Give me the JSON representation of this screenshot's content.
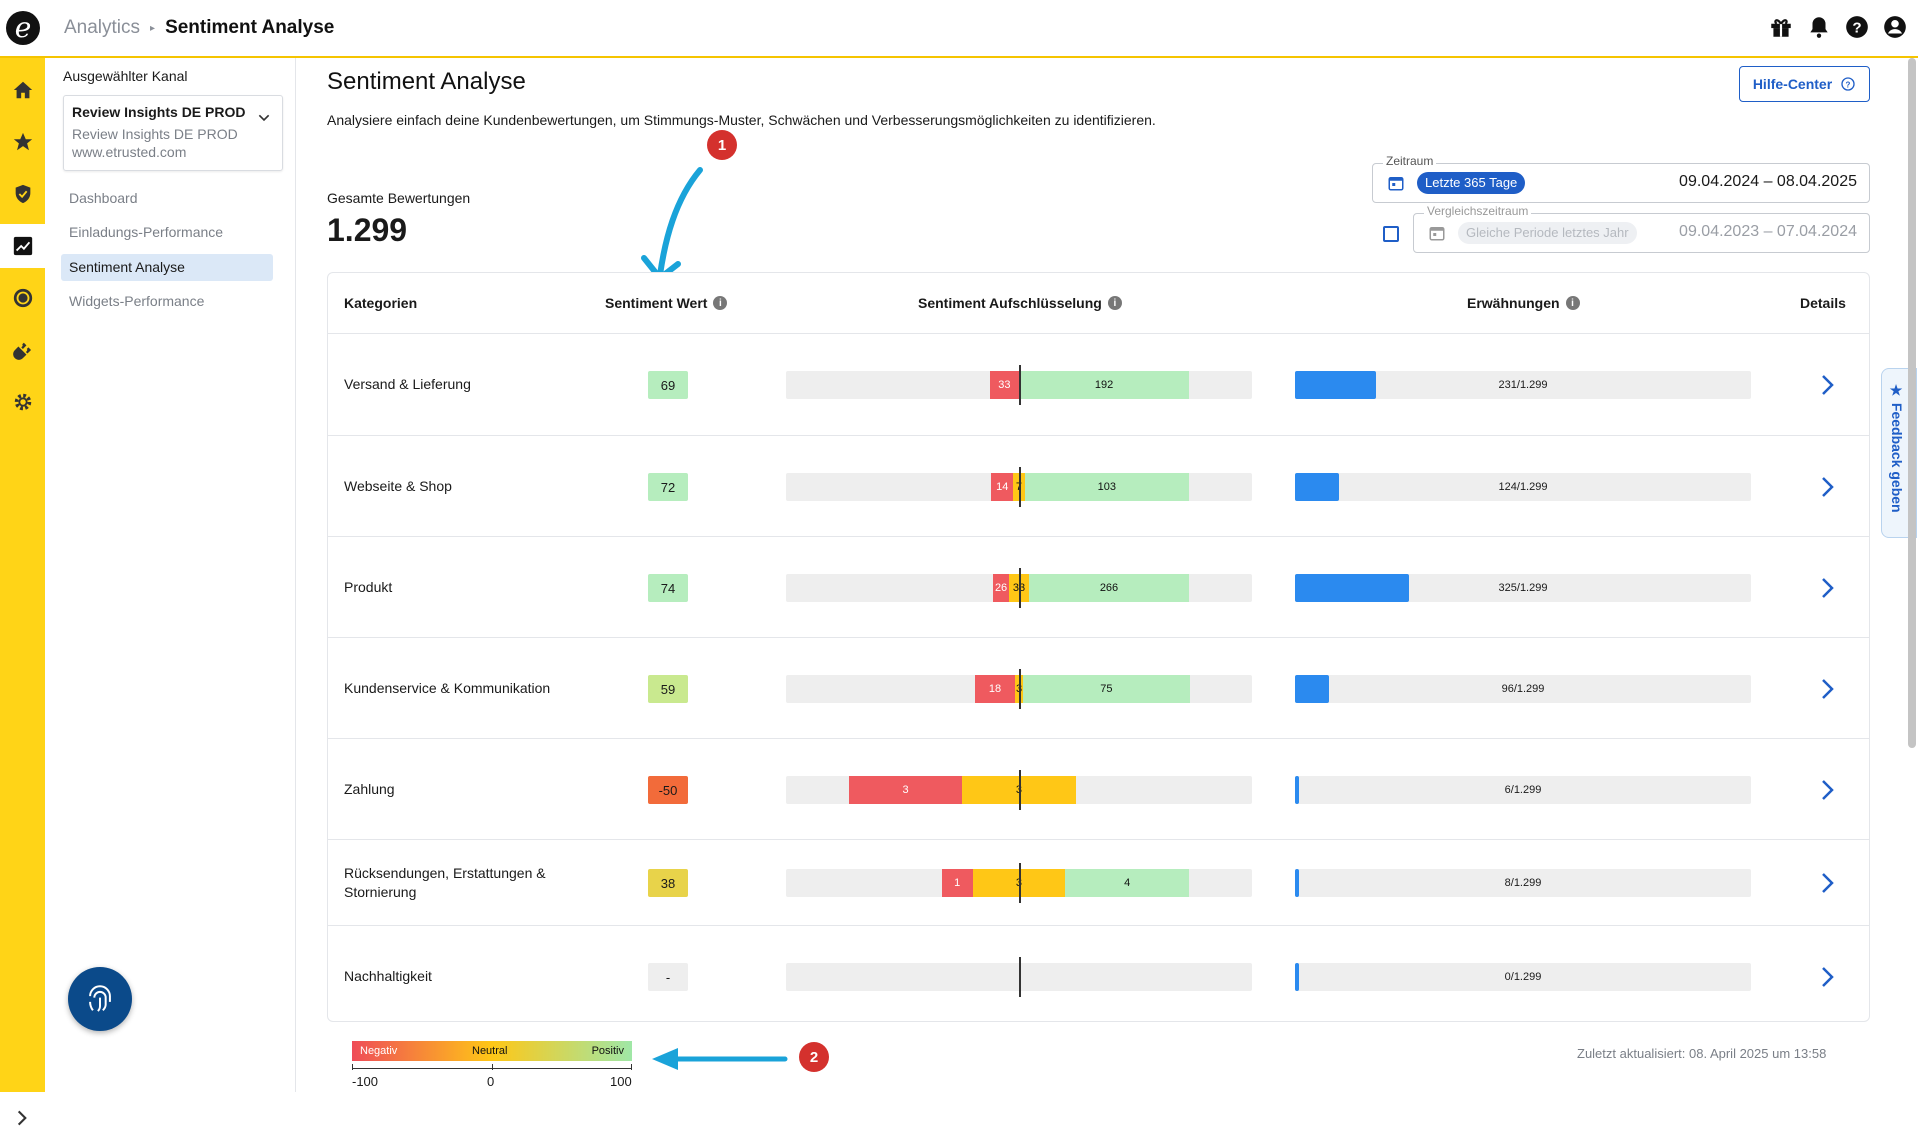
{
  "topbar": {
    "logo_letter": "e",
    "breadcrumb_parent": "Analytics",
    "breadcrumb_current": "Sentiment Analyse",
    "icons": [
      "gift-icon",
      "bell-icon",
      "help-icon",
      "user-icon"
    ]
  },
  "rail": {
    "items": [
      "home-icon",
      "star-icon",
      "shield-icon",
      "analytics-icon",
      "coin-icon",
      "plug-icon",
      "gear-icon"
    ],
    "active": "analytics-icon"
  },
  "sidenav": {
    "channel_label": "Ausgewählter Kanal",
    "channel_name": "Review Insights DE PROD",
    "channel_sub": "Review Insights DE PROD",
    "channel_url": "www.etrusted.com",
    "items": [
      {
        "label": "Dashboard"
      },
      {
        "label": "Einladungs-Performance"
      },
      {
        "label": "Sentiment Analyse"
      },
      {
        "label": "Widgets-Performance"
      }
    ],
    "active_index": 2
  },
  "main": {
    "title": "Sentiment Analyse",
    "description": "Analysiere einfach deine Kundenbewertungen, um Stimmungs-Muster, Schwächen und Verbesserungsmöglichkeiten zu identifizieren.",
    "help_button": "Hilfe-Center",
    "total_label": "Gesamte Bewertungen",
    "total_value": "1.299",
    "period": {
      "legend": "Zeitraum",
      "chip": "Letzte 365 Tage",
      "range": "09.04.2024 – 08.04.2025"
    },
    "compare": {
      "legend": "Vergleichszeitraum",
      "chip": "Gleiche Periode letztes Jahr",
      "range": "09.04.2023 – 07.04.2024",
      "checked": false
    }
  },
  "table": {
    "headers": {
      "category": "Kategorien",
      "score": "Sentiment Wert",
      "breakdown": "Sentiment Aufschlüsselung",
      "mentions": "Erwähnungen",
      "details": "Details"
    },
    "total_reviews": 1299,
    "rows": [
      {
        "category": "Versand & Lieferung",
        "score": "69",
        "score_color": "#b6edbe",
        "negative": "33",
        "neutral": "",
        "positive": "192",
        "mentions": "231/1.299"
      },
      {
        "category": "Webseite & Shop",
        "score": "72",
        "score_color": "#b6edbe",
        "negative": "14",
        "neutral": "7",
        "positive": "103",
        "mentions": "124/1.299"
      },
      {
        "category": "Produkt",
        "score": "74",
        "score_color": "#b6edbe",
        "negative": "26",
        "neutral": "33",
        "positive": "266",
        "mentions": "325/1.299"
      },
      {
        "category": "Kundenservice & Kommunikation",
        "score": "59",
        "score_color": "#c9e98f",
        "negative": "18",
        "neutral": "3",
        "positive": "75",
        "mentions": "96/1.299"
      },
      {
        "category": "Zahlung",
        "score": "-50",
        "score_color": "#f26b3a",
        "negative": "3",
        "neutral": "3",
        "positive": "",
        "mentions": "6/1.299"
      },
      {
        "category": "Rücksendungen, Erstattungen & Stornierung",
        "score": "38",
        "score_color": "#e8d34a",
        "negative": "1",
        "neutral": "3",
        "positive": "4",
        "mentions": "8/1.299"
      },
      {
        "category": "Nachhaltigkeit",
        "score": "-",
        "score_color": "#eeeeee",
        "negative": "",
        "neutral": "",
        "positive": "",
        "mentions": "0/1.299"
      }
    ]
  },
  "legend": {
    "negative": "Negativ",
    "neutral": "Neutral",
    "positive": "Positiv",
    "ticks": [
      "-100",
      "0",
      "100"
    ]
  },
  "annotations": [
    "1",
    "2"
  ],
  "footer": {
    "updated": "Zuletzt aktualisiert: 08. April 2025 um 13:58"
  },
  "feedback": {
    "label": "★ Feedback geben"
  }
}
